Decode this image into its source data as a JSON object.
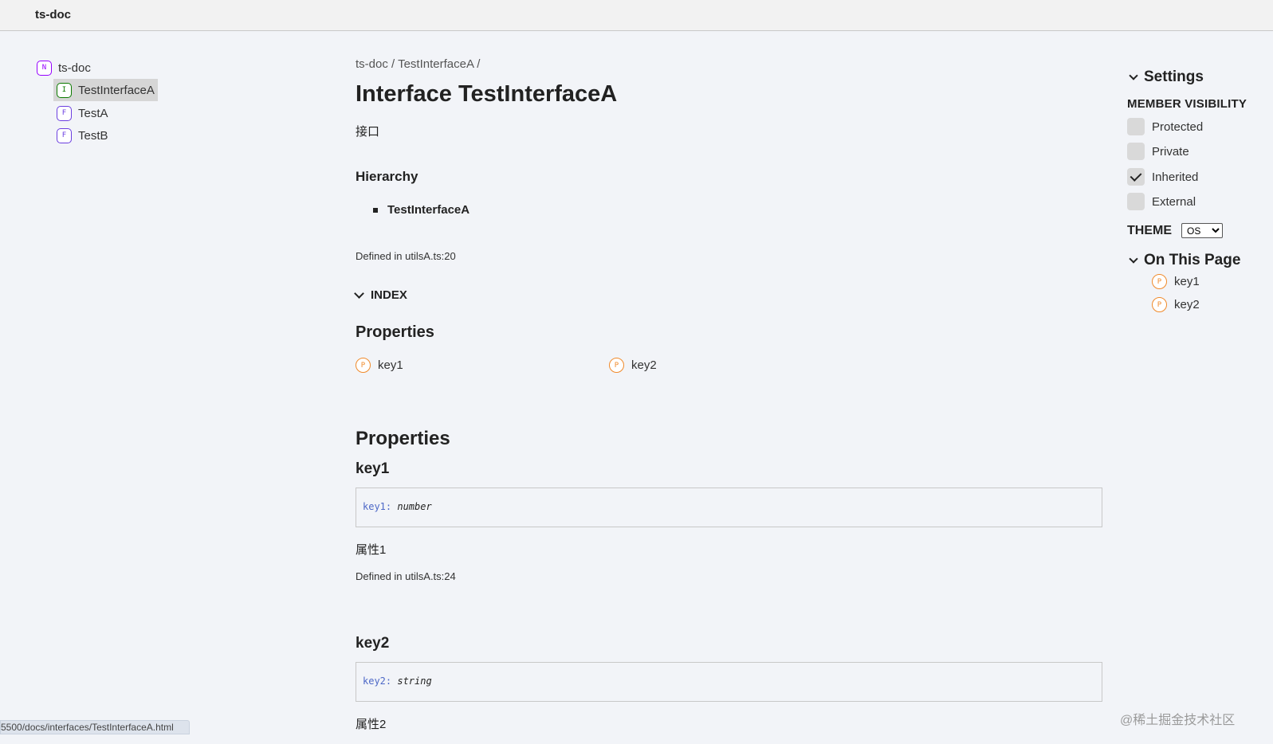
{
  "toolbar": {
    "brand": "ts-doc"
  },
  "nav": {
    "root": {
      "icon": "N",
      "label": "ts-doc"
    },
    "children": [
      {
        "icon": "I",
        "label": "TestInterfaceA",
        "active": true
      },
      {
        "icon": "F",
        "label": "TestA"
      },
      {
        "icon": "F",
        "label": "TestB"
      }
    ]
  },
  "main": {
    "breadcrumb": "ts-doc / TestInterfaceA /",
    "title": "Interface TestInterfaceA",
    "description": "接口",
    "hierarchy": {
      "heading": "Hierarchy",
      "items": [
        "TestInterfaceA"
      ]
    },
    "defined_in": "Defined in utilsA.ts:20",
    "index_toggle": "INDEX",
    "index": {
      "heading": "Properties",
      "items": [
        {
          "icon": "P",
          "label": "key1"
        },
        {
          "icon": "P",
          "label": "key2"
        }
      ]
    },
    "properties_heading": "Properties",
    "members": [
      {
        "name": "key1",
        "sig_name": "key1:",
        "sig_type": "number",
        "comment": "属性1",
        "defined_in": "Defined in utilsA.ts:24"
      },
      {
        "name": "key2",
        "sig_name": "key2:",
        "sig_type": "string",
        "comment": "属性2"
      }
    ]
  },
  "settings": {
    "heading": "Settings",
    "visibility_label": "MEMBER VISIBILITY",
    "options": [
      {
        "label": "Protected",
        "checked": false
      },
      {
        "label": "Private",
        "checked": false
      },
      {
        "label": "Inherited",
        "checked": true
      },
      {
        "label": "External",
        "checked": false
      }
    ],
    "theme_label": "THEME",
    "theme_value": "OS",
    "on_this_page": "On This Page",
    "page_links": [
      {
        "icon": "P",
        "label": "key1"
      },
      {
        "icon": "P",
        "label": "key2"
      }
    ]
  },
  "status_url": "5500/docs/interfaces/TestInterfaceA.html",
  "watermark": "@稀土掘金技术社区",
  "colors": {
    "namespace": "#9600ff",
    "interface": "#0c7a00",
    "function": "#6b3ee0",
    "property": "#f08a2a",
    "signature_name": "#4d68c7"
  }
}
